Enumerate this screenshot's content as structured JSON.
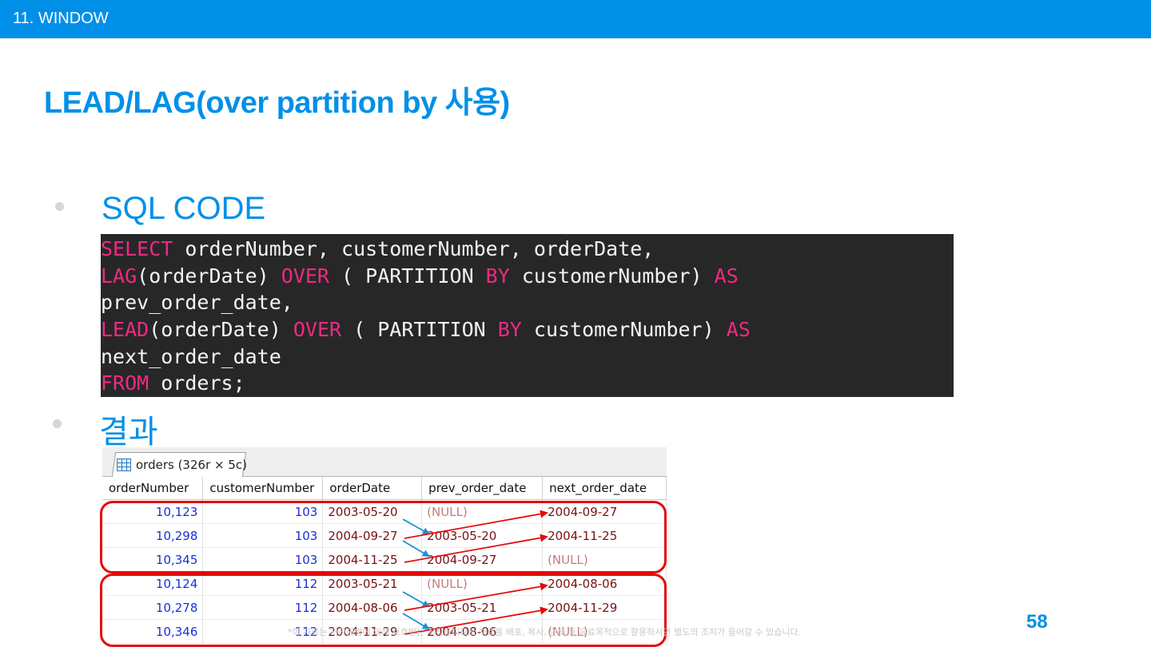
{
  "header": {
    "section": "11. WINDOW"
  },
  "title": "LEAD/LAG(over partition by 사용)",
  "bullets": {
    "sql": "SQL CODE",
    "result": "결과"
  },
  "code_lines": [
    [
      {
        "t": "SELECT",
        "kw": true
      },
      {
        "t": " orderNumber, customerNumber, orderDate,",
        "kw": false
      }
    ],
    [
      {
        "t": "LAG",
        "kw": true
      },
      {
        "t": "(orderDate) ",
        "kw": false
      },
      {
        "t": "OVER",
        "kw": true
      },
      {
        "t": " ( PARTITION ",
        "kw": false
      },
      {
        "t": "BY",
        "kw": true
      },
      {
        "t": " customerNumber) ",
        "kw": false
      },
      {
        "t": "AS",
        "kw": true
      }
    ],
    [
      {
        "t": "prev_order_date,",
        "kw": false
      }
    ],
    [
      {
        "t": "LEAD",
        "kw": true
      },
      {
        "t": "(orderDate) ",
        "kw": false
      },
      {
        "t": "OVER",
        "kw": true
      },
      {
        "t": " ( PARTITION ",
        "kw": false
      },
      {
        "t": "BY",
        "kw": true
      },
      {
        "t": " customerNumber) ",
        "kw": false
      },
      {
        "t": "AS",
        "kw": true
      }
    ],
    [
      {
        "t": "next_order_date",
        "kw": false
      }
    ],
    [
      {
        "t": "FROM",
        "kw": true
      },
      {
        "t": " orders;",
        "kw": false
      }
    ]
  ],
  "result_grid": {
    "tab_label": "orders (326r × 5c)",
    "icon": "table-icon",
    "columns": [
      "orderNumber",
      "customerNumber",
      "orderDate",
      "prev_order_date",
      "next_order_date"
    ],
    "rows": [
      [
        "10,123",
        "103",
        "2003-05-20",
        "(NULL)",
        "2004-09-27"
      ],
      [
        "10,298",
        "103",
        "2004-09-27",
        "2003-05-20",
        "2004-11-25"
      ],
      [
        "10,345",
        "103",
        "2004-11-25",
        "2004-09-27",
        "(NULL)"
      ],
      [
        "10,124",
        "112",
        "2003-05-21",
        "(NULL)",
        "2004-08-06"
      ],
      [
        "10,278",
        "112",
        "2004-08-06",
        "2003-05-21",
        "2004-11-29"
      ],
      [
        "10,346",
        "112",
        "2004-11-29",
        "2004-08-06",
        "(NULL)"
      ]
    ]
  },
  "colors": {
    "accent": "#0090e8",
    "keyword": "#ee2a83",
    "highlight_box": "#e30b0b",
    "lag_arrow": "#1a8fd8",
    "lead_arrow": "#e30b0b"
  },
  "footer_note": "*이 자료는 저작권법에 의해 보호받는 저작물이므로 자료를 배포, 복사, 인쇄 등 유료목적으로 활용하시면 별도의 조치가 들어갈 수 있습니다.",
  "page_number": "58"
}
